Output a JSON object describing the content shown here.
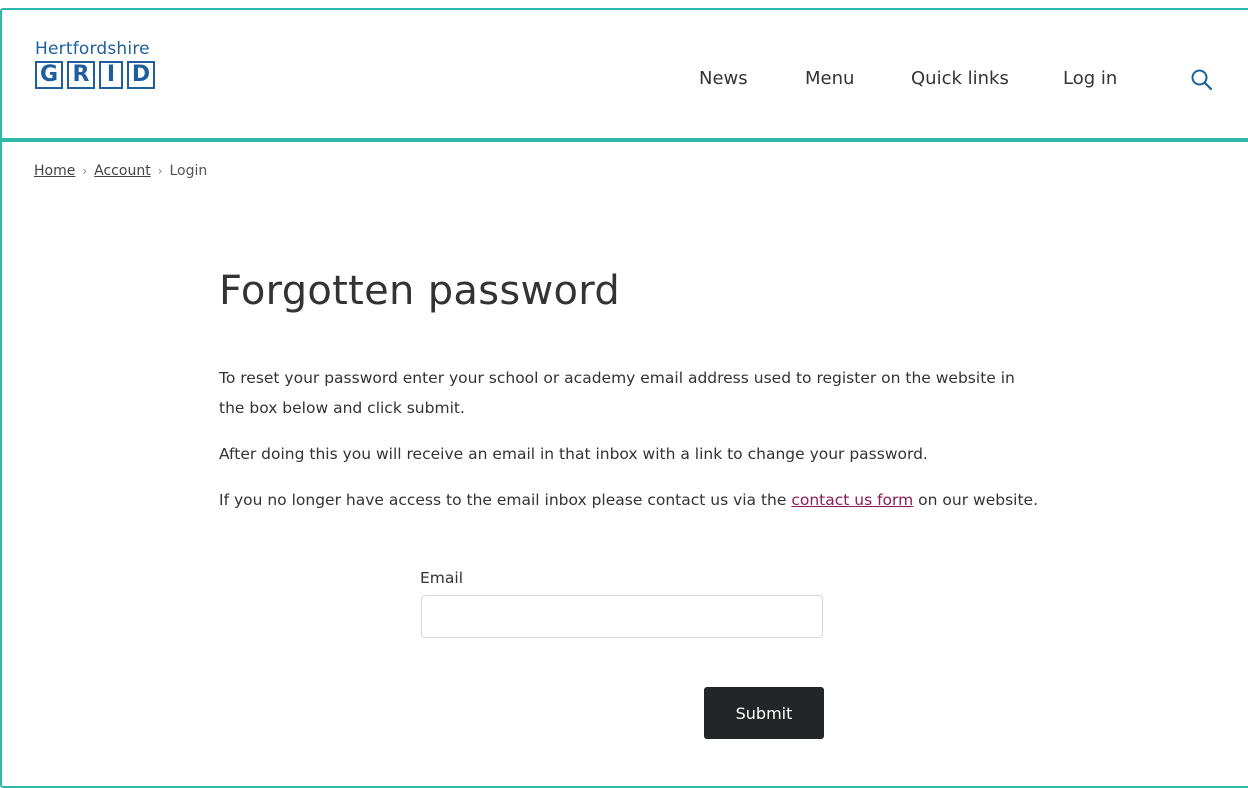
{
  "header": {
    "logo": {
      "top_text": "Hertfordshire",
      "letters": [
        "G",
        "R",
        "I",
        "D"
      ]
    },
    "nav": [
      "News",
      "Menu",
      "Quick links",
      "Log in"
    ],
    "search_icon": "search-icon"
  },
  "breadcrumb": {
    "items": [
      "Home",
      "Account",
      "Login"
    ],
    "separator": "›"
  },
  "main": {
    "title": "Forgotten password",
    "para1": "To reset your password enter your school or academy email address used to register on the website in the box below and click submit.",
    "para2": "After doing this you will receive an email in that inbox with a link to change your password.",
    "para3_before": "If you no longer have access to the email inbox please contact us via the ",
    "para3_link": "contact us form",
    "para3_after": " on our website.",
    "email_label": "Email",
    "email_value": "",
    "submit_label": "Submit"
  },
  "colors": {
    "accent": "#2fb7a9",
    "logo_blue": "#1f5f9e",
    "link_purple": "#8b1c5a",
    "button_dark": "#222629"
  }
}
